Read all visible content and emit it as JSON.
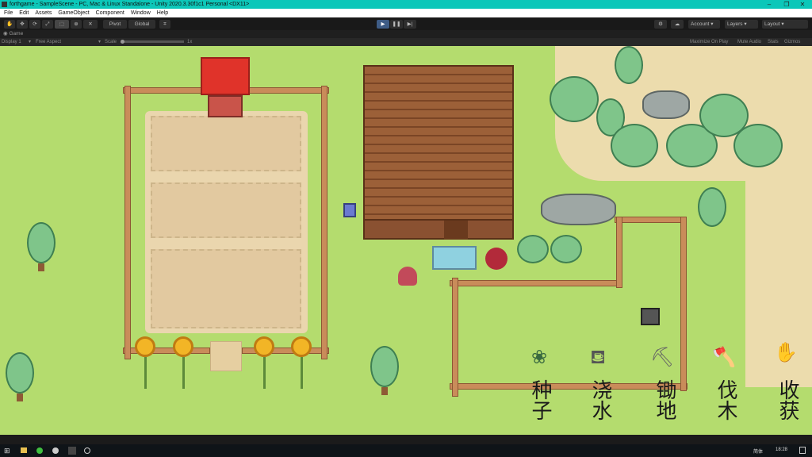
{
  "window": {
    "title": "forthgame - SampleScene - PC, Mac & Linux Standalone - Unity 2020.3.30f1c1 Personal <DX11>",
    "min": "–",
    "max": "❐",
    "close": "✕"
  },
  "menu": [
    "File",
    "Edit",
    "Assets",
    "GameObject",
    "Component",
    "Window",
    "Help"
  ],
  "toolbar": {
    "pivot": "Pivot",
    "global": "Global",
    "account": "Account",
    "layers": "Layers",
    "layout": "Layout",
    "play": "▶",
    "pause": "❚❚",
    "step": "▶|"
  },
  "game_tab": {
    "label": "Game",
    "display": "Display 1",
    "aspect": "Free Aspect",
    "scale_label": "Scale",
    "scale_value": "1x",
    "maximize": "Maximize On Play",
    "mute": "Mute Audio",
    "stats": "Stats",
    "gizmos": "Gizmos"
  },
  "tools": [
    {
      "label": "种子",
      "icon": "seed-icon"
    },
    {
      "label": "浇水",
      "icon": "watering-can-icon"
    },
    {
      "label": "锄地",
      "icon": "hoe-icon"
    },
    {
      "label": "伐木",
      "icon": "axe-icon"
    },
    {
      "label": "收获",
      "icon": "hand-icon"
    }
  ],
  "taskbar": {
    "time": "18:28",
    "ime": "简体"
  }
}
